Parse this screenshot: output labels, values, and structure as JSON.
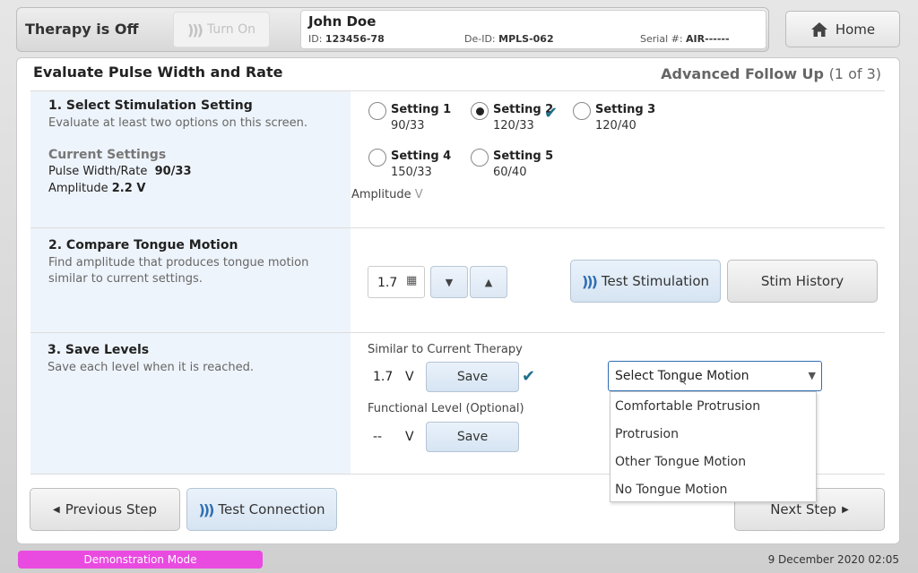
{
  "topbar": {
    "therapy_status": "Therapy is Off",
    "turn_on_label": "Turn On",
    "patient": {
      "name": "John Doe",
      "id_label": "ID:",
      "id_value": "123456-78",
      "deid_label": "De-ID:",
      "deid_value": "MPLS-062",
      "serial_label": "Serial #:",
      "serial_value": "AIR------"
    },
    "home_label": "Home"
  },
  "main": {
    "title": "Evaluate Pulse Width and Rate",
    "subtitle": "Advanced Follow Up",
    "step": "(1 of 3)"
  },
  "section1": {
    "title": "1. Select Stimulation Setting",
    "desc": "Evaluate at least two options on this screen.",
    "current_label": "Current Settings",
    "pw_label": "Pulse Width/Rate",
    "pw_value": "90/33",
    "amp_label": "Amplitude",
    "amp_value": "2.2 V",
    "settings": [
      {
        "label": "Setting 1",
        "value": "90/33",
        "selected": false,
        "checked": false
      },
      {
        "label": "Setting 2",
        "value": "120/33",
        "selected": true,
        "checked": true
      },
      {
        "label": "Setting 3",
        "value": "120/40",
        "selected": false,
        "checked": false
      },
      {
        "label": "Setting 4",
        "value": "150/33",
        "selected": false,
        "checked": false
      },
      {
        "label": "Setting 5",
        "value": "60/40",
        "selected": false,
        "checked": false
      }
    ]
  },
  "section2": {
    "title": "2. Compare Tongue Motion",
    "desc": "Find amplitude that produces tongue motion similar to current settings.",
    "amplitude_label": "Amplitude",
    "amplitude_unit": "V",
    "amplitude_value": "1.7",
    "test_stim_label": "Test Stimulation",
    "stim_history_label": "Stim History"
  },
  "section3": {
    "title": "3. Save Levels",
    "desc": "Save each level when it is reached.",
    "similar_label": "Similar to Current Therapy",
    "similar_value": "1.7",
    "unit": "V",
    "save_label": "Save",
    "functional_label": "Functional Level (Optional)",
    "functional_value": "--",
    "dropdown_value": "Select Tongue Motion",
    "dropdown_options": [
      "Comfortable Protrusion",
      "Protrusion",
      "Other Tongue Motion",
      "No Tongue Motion"
    ]
  },
  "footer": {
    "prev_label": "Previous Step",
    "test_conn_label": "Test Connection",
    "next_label": "Next Step",
    "demo_mode": "Demonstration Mode",
    "datetime": "9 December 2020 02:05"
  },
  "colors": {
    "accent_blue": "#2f6fb3",
    "check_teal": "#1e6f8c",
    "demo_pink": "#e94be0"
  }
}
